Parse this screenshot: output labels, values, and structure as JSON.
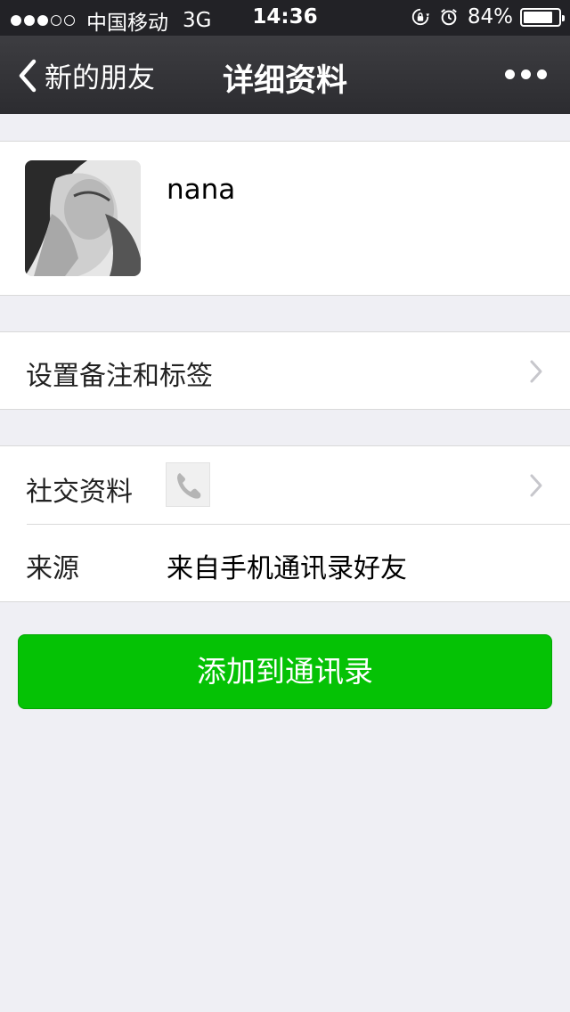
{
  "status_bar": {
    "signal_filled": 3,
    "signal_total": 5,
    "carrier": "中国移动",
    "network": "3G",
    "time": "14:36",
    "battery_percent": "84%",
    "battery_level": 0.84,
    "icons": [
      "rotation-lock-icon",
      "alarm-icon"
    ]
  },
  "nav": {
    "back_label": "新的朋友",
    "title": "详细资料",
    "more_icon": "more-dots-icon"
  },
  "profile": {
    "name": "nana"
  },
  "remark_row": {
    "label": "设置备注和标签"
  },
  "social_row": {
    "label": "社交资料",
    "icon": "phone-icon"
  },
  "source_row": {
    "label": "来源",
    "value": "来自手机通讯录好友"
  },
  "add_button": {
    "label": "添加到通讯录"
  },
  "colors": {
    "accent_green": "#05c205",
    "nav_background": "#2c2c30",
    "page_background": "#efeff4"
  }
}
